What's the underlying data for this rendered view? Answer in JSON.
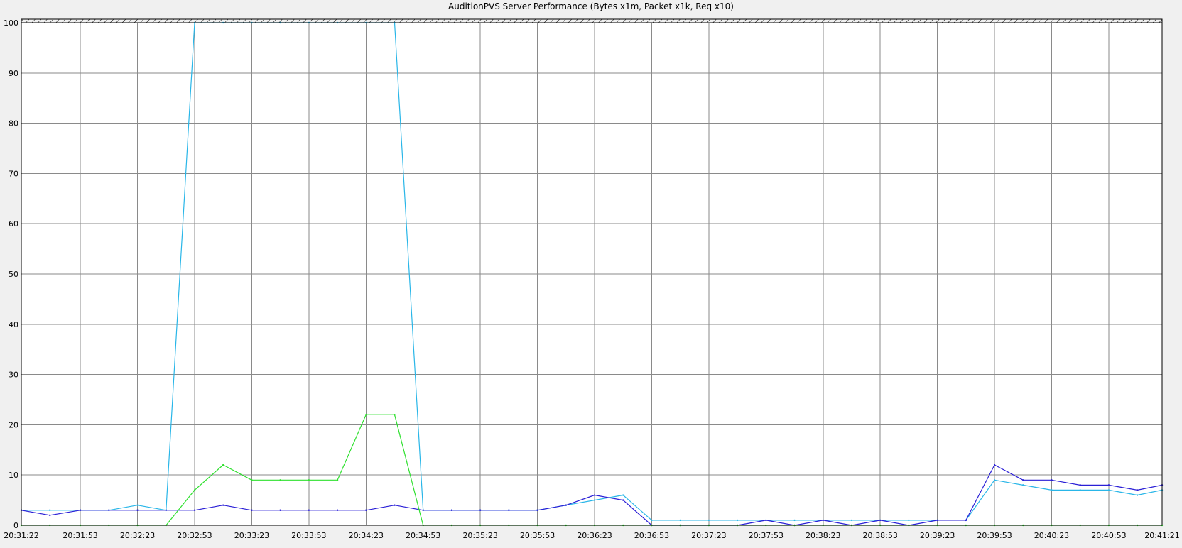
{
  "chart_data": {
    "type": "line",
    "title": "AuditionPVS Server Performance (Bytes x1m, Packet x1k, Req x10)",
    "xlabel": "",
    "ylabel": "",
    "ylim": [
      0,
      100
    ],
    "yticks": [
      0,
      10,
      20,
      30,
      40,
      50,
      60,
      70,
      80,
      90,
      100
    ],
    "xticks": [
      "20:31:22",
      "20:31:53",
      "20:32:23",
      "20:32:53",
      "20:33:23",
      "20:33:53",
      "20:34:23",
      "20:34:53",
      "20:35:23",
      "20:35:53",
      "20:36:23",
      "20:36:53",
      "20:37:23",
      "20:37:53",
      "20:38:23",
      "20:38:53",
      "20:39:23",
      "20:39:53",
      "20:40:23",
      "20:40:53",
      "20:41:21"
    ],
    "x": [
      "20:31:22",
      "20:31:37",
      "20:31:53",
      "20:32:08",
      "20:32:23",
      "20:32:38",
      "20:32:53",
      "20:33:08",
      "20:33:23",
      "20:33:38",
      "20:33:53",
      "20:34:08",
      "20:34:23",
      "20:34:38",
      "20:34:53",
      "20:35:08",
      "20:35:23",
      "20:35:38",
      "20:35:53",
      "20:36:08",
      "20:36:23",
      "20:36:38",
      "20:36:53",
      "20:37:08",
      "20:37:23",
      "20:37:38",
      "20:37:53",
      "20:38:08",
      "20:38:23",
      "20:38:38",
      "20:38:53",
      "20:39:08",
      "20:39:23",
      "20:39:38",
      "20:39:53",
      "20:40:08",
      "20:40:23",
      "20:40:38",
      "20:40:53",
      "20:41:08",
      "20:41:21"
    ],
    "grid": true,
    "legend": "none",
    "series": [
      {
        "color": "#29b6e8",
        "values": [
          3,
          3,
          3,
          3,
          4,
          3,
          100,
          100,
          100,
          100,
          100,
          100,
          100,
          100,
          3,
          3,
          3,
          3,
          3,
          4,
          5,
          6,
          1,
          1,
          1,
          1,
          1,
          1,
          1,
          1,
          1,
          1,
          1,
          1,
          9,
          8,
          7,
          7,
          7,
          6,
          7
        ]
      },
      {
        "color": "#2a1fd6",
        "values": [
          3,
          2,
          3,
          3,
          3,
          3,
          3,
          4,
          3,
          3,
          3,
          3,
          3,
          4,
          3,
          3,
          3,
          3,
          3,
          4,
          6,
          5,
          0,
          0,
          0,
          0,
          1,
          0,
          1,
          0,
          1,
          0,
          1,
          1,
          12,
          9,
          9,
          8,
          8,
          7,
          8
        ]
      },
      {
        "color": "#2fe02f",
        "values": [
          0,
          0,
          0,
          0,
          0,
          0,
          7,
          12,
          9,
          9,
          9,
          9,
          22,
          22,
          0,
          0,
          0,
          0,
          0,
          0,
          0,
          0,
          0,
          0,
          0,
          0,
          0,
          0,
          0,
          0,
          0,
          0,
          0,
          0,
          0,
          0,
          0,
          0,
          0,
          0,
          0
        ]
      }
    ]
  }
}
